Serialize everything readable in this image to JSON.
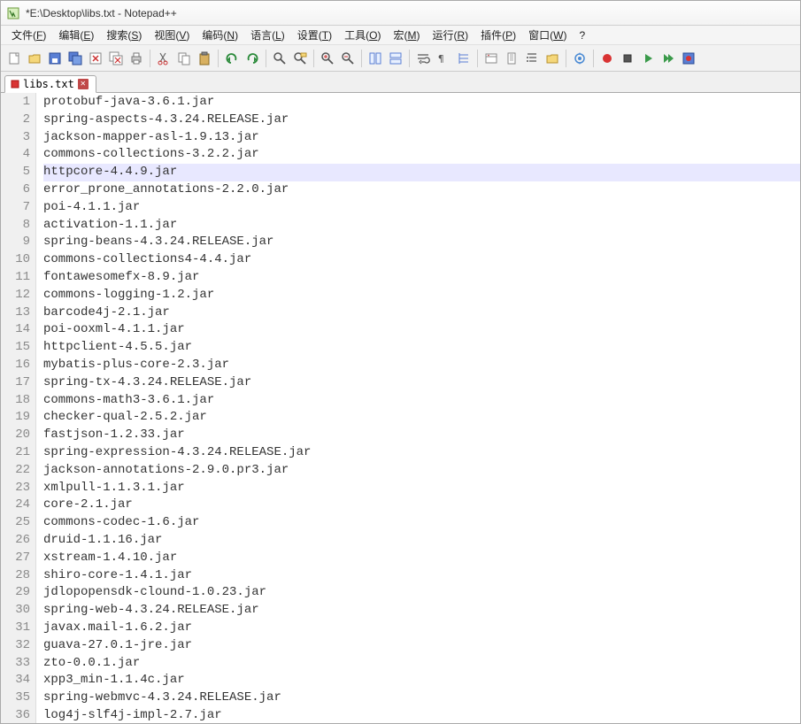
{
  "window": {
    "title": "*E:\\Desktop\\libs.txt - Notepad++"
  },
  "menu": {
    "items": [
      {
        "label": "文件",
        "key": "F"
      },
      {
        "label": "编辑",
        "key": "E"
      },
      {
        "label": "搜索",
        "key": "S"
      },
      {
        "label": "视图",
        "key": "V"
      },
      {
        "label": "编码",
        "key": "N"
      },
      {
        "label": "语言",
        "key": "L"
      },
      {
        "label": "设置",
        "key": "T"
      },
      {
        "label": "工具",
        "key": "O"
      },
      {
        "label": "宏",
        "key": "M"
      },
      {
        "label": "运行",
        "key": "R"
      },
      {
        "label": "插件",
        "key": "P"
      },
      {
        "label": "窗口",
        "key": "W"
      },
      {
        "label": "?",
        "key": ""
      }
    ]
  },
  "toolbar": {
    "groups": [
      [
        "new-file-icon",
        "open-file-icon",
        "save-icon",
        "save-all-icon",
        "close-icon",
        "close-all-icon",
        "print-icon"
      ],
      [
        "cut-icon",
        "copy-icon",
        "paste-icon"
      ],
      [
        "undo-icon",
        "redo-icon"
      ],
      [
        "find-icon",
        "replace-icon"
      ],
      [
        "zoom-in-icon",
        "zoom-out-icon"
      ],
      [
        "sync-v-icon",
        "sync-h-icon"
      ],
      [
        "wrap-icon",
        "show-all-chars-icon",
        "indent-guide-icon"
      ],
      [
        "lang-icon",
        "doc-map-icon",
        "function-list-icon",
        "folder-icon"
      ],
      [
        "monitor-icon"
      ],
      [
        "record-icon",
        "stop-icon",
        "play-icon",
        "play-multi-icon",
        "save-macro-icon"
      ]
    ]
  },
  "tabs": {
    "active": {
      "label": "libs.txt",
      "modified": true
    }
  },
  "editor": {
    "highlighted_line": 5,
    "lines": [
      "protobuf-java-3.6.1.jar",
      "spring-aspects-4.3.24.RELEASE.jar",
      "jackson-mapper-asl-1.9.13.jar",
      "commons-collections-3.2.2.jar",
      "httpcore-4.4.9.jar",
      "error_prone_annotations-2.2.0.jar",
      "poi-4.1.1.jar",
      "activation-1.1.jar",
      "spring-beans-4.3.24.RELEASE.jar",
      "commons-collections4-4.4.jar",
      "fontawesomefx-8.9.jar",
      "commons-logging-1.2.jar",
      "barcode4j-2.1.jar",
      "poi-ooxml-4.1.1.jar",
      "httpclient-4.5.5.jar",
      "mybatis-plus-core-2.3.jar",
      "spring-tx-4.3.24.RELEASE.jar",
      "commons-math3-3.6.1.jar",
      "checker-qual-2.5.2.jar",
      "fastjson-1.2.33.jar",
      "spring-expression-4.3.24.RELEASE.jar",
      "jackson-annotations-2.9.0.pr3.jar",
      "xmlpull-1.1.3.1.jar",
      "core-2.1.jar",
      "commons-codec-1.6.jar",
      "druid-1.1.16.jar",
      "xstream-1.4.10.jar",
      "shiro-core-1.4.1.jar",
      "jdlopopensdk-clound-1.0.23.jar",
      "spring-web-4.3.24.RELEASE.jar",
      "javax.mail-1.6.2.jar",
      "guava-27.0.1-jre.jar",
      "zto-0.0.1.jar",
      "xpp3_min-1.1.4c.jar",
      "spring-webmvc-4.3.24.RELEASE.jar",
      "log4j-slf4j-impl-2.7.jar"
    ]
  }
}
